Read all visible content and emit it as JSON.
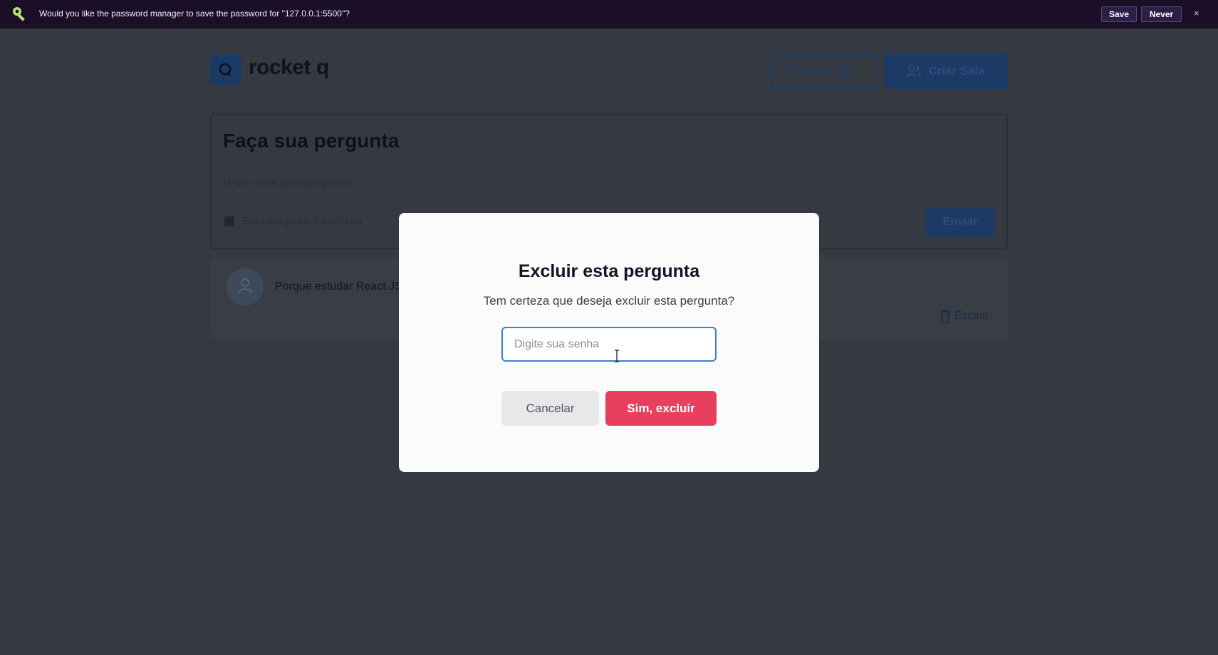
{
  "password_bar": {
    "message": "Would you like the password manager to save the password for \"127.0.0.1:5500\"?",
    "save_label": "Save",
    "never_label": "Never",
    "close_label": "×",
    "icon": "key-icon"
  },
  "header": {
    "logo_text": "rocket",
    "logo_dot": ".",
    "logo_suffix": "q",
    "room_code": "#764665",
    "create_room_label": "Criar Sala"
  },
  "ask_form": {
    "title": "Faça sua pergunta",
    "placeholder": "O que você quer perguntar",
    "anonymous_label": "Esta pergunta é anônima",
    "send_label": "Enviar"
  },
  "questions": [
    {
      "text": "Porque estudar React.JS",
      "delete_label": "Excluir"
    }
  ],
  "modal": {
    "title": "Excluir esta pergunta",
    "description": "Tem certeza que deseja excluir esta pergunta?",
    "password_placeholder": "Digite sua senha",
    "password_value": "",
    "cancel_label": "Cancelar",
    "confirm_label": "Sim, excluir"
  },
  "colors": {
    "accent": "#1b3a66",
    "danger": "#e73f5d",
    "overlay": "#353941",
    "focus": "#3d7fd1"
  }
}
